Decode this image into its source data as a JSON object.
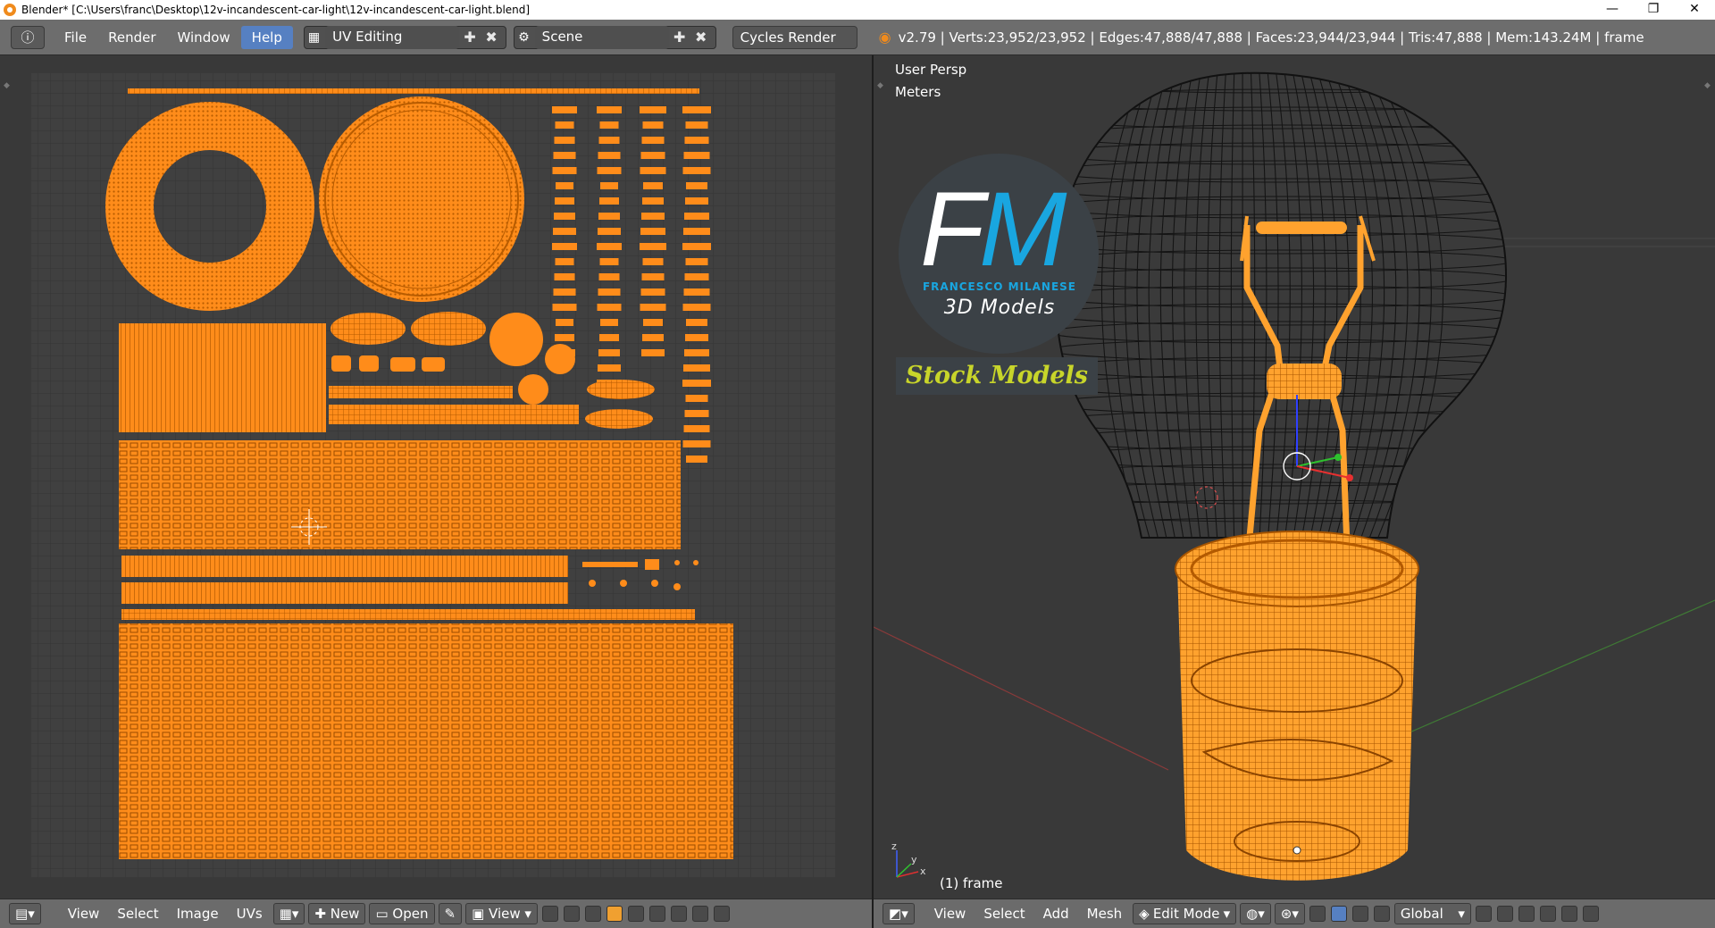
{
  "window": {
    "title": "Blender* [C:\\Users\\franc\\Desktop\\12v-incandescent-car-light\\12v-incandescent-car-light.blend]",
    "controls": [
      "—",
      "❐",
      "✕"
    ]
  },
  "infobar": {
    "menus": [
      "File",
      "Render",
      "Window",
      "Help"
    ],
    "active_menu": "Help",
    "screen_layout": "UV Editing",
    "scene": "Scene",
    "render_engine": "Cycles Render",
    "stats": "v2.79 | Verts:23,952/23,952 | Edges:47,888/47,888 | Faces:23,944/23,944 | Tris:47,888 | Mem:143.24M | frame"
  },
  "uv_editor": {
    "footer": {
      "menus": [
        "View",
        "Select",
        "Image",
        "UVs"
      ],
      "new_label": "New",
      "open_label": "Open",
      "view_label": "View"
    }
  },
  "viewport": {
    "view_name": "User Persp",
    "units": "Meters",
    "object_label": "(1) frame",
    "footer": {
      "menus": [
        "View",
        "Select",
        "Add",
        "Mesh"
      ],
      "mode": "Edit Mode",
      "orientation": "Global"
    }
  },
  "watermark": {
    "initials_f": "F",
    "initials_m": "M",
    "author": "FRANCESCO MILANESE",
    "tagline": "3D Models",
    "banner": "Stock Models"
  },
  "colors": {
    "mesh_orange": "#ff8c1a",
    "header_gray": "#6d6d6d",
    "active_blue": "#5680c2",
    "logo_blue": "#19a6e0",
    "stock_yellow": "#c8d52a"
  }
}
